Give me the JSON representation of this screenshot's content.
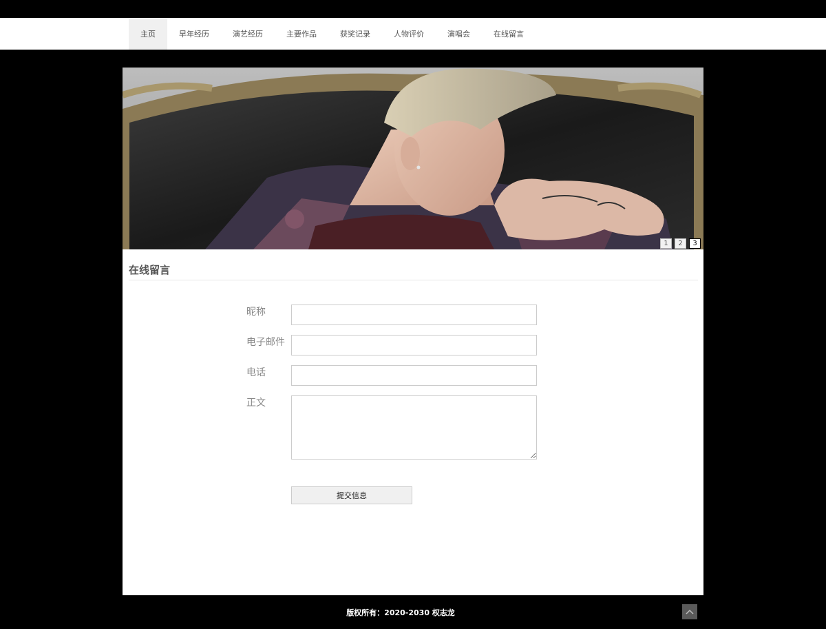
{
  "nav": {
    "items": [
      {
        "label": "主页",
        "active": true
      },
      {
        "label": "早年经历"
      },
      {
        "label": "演艺经历"
      },
      {
        "label": "主要作品"
      },
      {
        "label": "获奖记录"
      },
      {
        "label": "人物评价"
      },
      {
        "label": "演唱会"
      },
      {
        "label": "在线留言"
      }
    ]
  },
  "banner": {
    "pager": [
      "1",
      "2",
      "3"
    ],
    "active_slide": "3"
  },
  "section": {
    "title": "在线留言"
  },
  "form": {
    "nickname_label": "昵称",
    "email_label": "电子邮件",
    "phone_label": "电话",
    "body_label": "正文",
    "submit_label": "提交信息"
  },
  "footer": {
    "copyright": "版权所有：2020-2030 权志龙"
  },
  "icons": {
    "back_to_top": "chevron-up-icon"
  }
}
